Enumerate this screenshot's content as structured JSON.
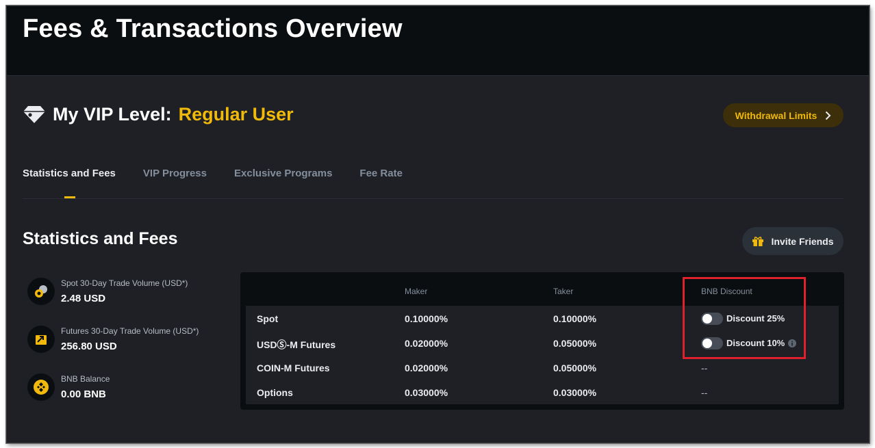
{
  "header": {
    "title": "Fees & Transactions Overview"
  },
  "vip": {
    "label": "My VIP Level:",
    "value": "Regular User",
    "withdraw_button": "Withdrawal Limits"
  },
  "tabs": [
    {
      "label": "Statistics and Fees",
      "active": true
    },
    {
      "label": "VIP Progress",
      "active": false
    },
    {
      "label": "Exclusive Programs",
      "active": false
    },
    {
      "label": "Fee Rate",
      "active": false
    }
  ],
  "section": {
    "title": "Statistics and Fees",
    "invite_button": "Invite Friends"
  },
  "stats": [
    {
      "label": "Spot 30-Day Trade Volume (USD*)",
      "value": "2.48 USD",
      "icon": "spot-volume-icon"
    },
    {
      "label": "Futures 30-Day Trade Volume (USD*)",
      "value": "256.80 USD",
      "icon": "futures-volume-icon"
    },
    {
      "label": "BNB Balance",
      "value": "0.00 BNB",
      "icon": "bnb-icon"
    }
  ],
  "fee_table": {
    "headers": {
      "market": "",
      "maker": "Maker",
      "taker": "Taker",
      "bnb": "BNB Discount"
    },
    "rows": [
      {
        "name": "Spot",
        "maker": "0.10000%",
        "taker": "0.10000%",
        "bnb": "Discount 25%",
        "toggle": false
      },
      {
        "name": "USDⓈ-M Futures",
        "maker": "0.02000%",
        "taker": "0.05000%",
        "bnb": "Discount 10%",
        "toggle": false
      },
      {
        "name": "COIN-M Futures",
        "maker": "0.02000%",
        "taker": "0.05000%",
        "bnb": "--"
      },
      {
        "name": "Options",
        "maker": "0.03000%",
        "taker": "0.03000%",
        "bnb": "--"
      }
    ]
  },
  "colors": {
    "accent": "#f0b90b",
    "background": "#1e2026",
    "header_bg": "#0b0e11",
    "highlight": "#e0202b"
  }
}
